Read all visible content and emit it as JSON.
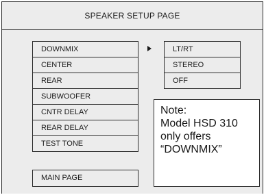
{
  "title": "SPEAKER SETUP PAGE",
  "menu": {
    "items": [
      {
        "label": "DOWNMIX"
      },
      {
        "label": "CENTER"
      },
      {
        "label": "REAR"
      },
      {
        "label": "SUBWOOFER"
      },
      {
        "label": "CNTR DELAY"
      },
      {
        "label": "REAR DELAY"
      },
      {
        "label": "TEST TONE"
      }
    ],
    "selected": "DOWNMIX",
    "pointer_icon": "triangle-right-icon"
  },
  "options": {
    "items": [
      {
        "label": "LT/RT"
      },
      {
        "label": "STEREO"
      },
      {
        "label": "OFF"
      }
    ]
  },
  "note": {
    "lines": [
      "Note:",
      "Model HSD 310",
      "only offers",
      "“DOWNMIX”"
    ]
  },
  "main_page_label": "MAIN PAGE"
}
